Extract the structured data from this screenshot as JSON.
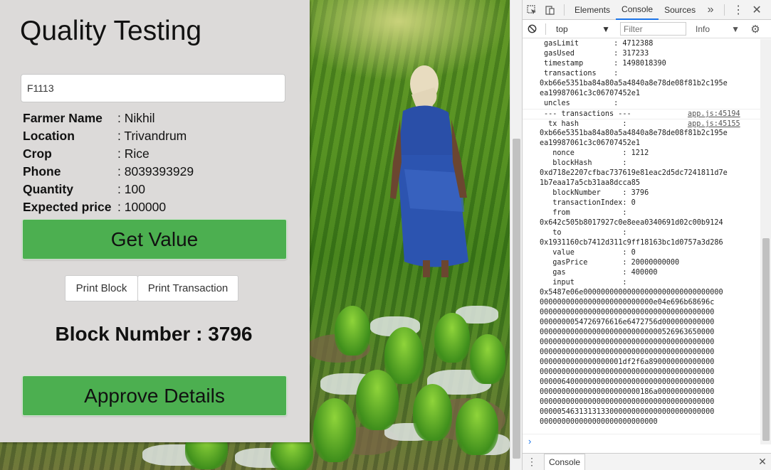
{
  "app": {
    "title": "Quality Testing",
    "farmer_id_value": "F1113",
    "details": [
      {
        "key": "Farmer Name",
        "value": ": Nikhil"
      },
      {
        "key": "Location",
        "value": ": Trivandrum"
      },
      {
        "key": "Crop",
        "value": ": Rice"
      },
      {
        "key": "Phone",
        "value": ": 8039393929"
      },
      {
        "key": "Quantity",
        "value": ": 100"
      },
      {
        "key": "Expected price",
        "value": ": 100000"
      }
    ],
    "get_value_label": "Get Value",
    "print_block_label": "Print Block",
    "print_transaction_label": "Print Transaction",
    "block_number_text": "Block Number : 3796",
    "approve_label": "Approve Details"
  },
  "devtools": {
    "tabs": [
      "Elements",
      "Console",
      "Sources"
    ],
    "active_tab": "Console",
    "more": "»",
    "context": "top",
    "filter_placeholder": "Filter",
    "level": "Info",
    "drawer_tab": "Console",
    "console_lines": [
      {
        "text": "gasLimit        : 4712388",
        "src": ""
      },
      {
        "text": "gasUsed         : 317233",
        "src": ""
      },
      {
        "text": "timestamp       : 1498018390",
        "src": ""
      },
      {
        "text": "transactions    :",
        "src": ""
      },
      {
        "text": "0xb66e5351ba84a80a5a4840a8e78de08f81b2c195e",
        "src": "",
        "flush": true
      },
      {
        "text": "ea19987061c3c06707452e1",
        "src": "",
        "flush": true
      },
      {
        "text": "uncles          :",
        "src": ""
      },
      {
        "text": "--- transactions ---",
        "src": "app.js:45194",
        "sep": true
      },
      {
        "text": " tx hash          :",
        "src": "app.js:45155",
        "sep": true
      },
      {
        "text": "0xb66e5351ba84a80a5a4840a8e78de08f81b2c195e",
        "src": "",
        "flush": true
      },
      {
        "text": "ea19987061c3c06707452e1",
        "src": "",
        "flush": true
      },
      {
        "text": "  nonce           : 1212",
        "src": ""
      },
      {
        "text": "  blockHash       :",
        "src": ""
      },
      {
        "text": "0xd718e2207cfbac737619e81eac2d5dc7241811d7e",
        "src": "",
        "flush": true
      },
      {
        "text": "1b7eaa17a5cb31aa8dcca85",
        "src": "",
        "flush": true
      },
      {
        "text": "  blockNumber     : 3796",
        "src": ""
      },
      {
        "text": "  transactionIndex: 0",
        "src": ""
      },
      {
        "text": "  from            :",
        "src": ""
      },
      {
        "text": "0x642c505b8017927c0e8eea0340691d02c00b9124",
        "src": "",
        "flush": true
      },
      {
        "text": "  to              :",
        "src": ""
      },
      {
        "text": "0x1931160cb7412d311c9ff18163bc1d0757a3d286",
        "src": "",
        "flush": true
      },
      {
        "text": "  value           : 0",
        "src": ""
      },
      {
        "text": "  gasPrice        : 20000000000",
        "src": ""
      },
      {
        "text": "  gas             : 400000",
        "src": ""
      },
      {
        "text": "  input           :",
        "src": ""
      },
      {
        "text": "0x5487e06e00000000000000000000000000000000",
        "src": "",
        "flush": true
      },
      {
        "text": "00000000000000000000000000e04e696b68696c",
        "src": "",
        "flush": true
      },
      {
        "text": "0000000000000000000000000000000000000000",
        "src": "",
        "flush": true
      },
      {
        "text": "0000000054726976616e6472756d000000000000",
        "src": "",
        "flush": true
      },
      {
        "text": "0000000000000000000000000000526963650000",
        "src": "",
        "flush": true
      },
      {
        "text": "0000000000000000000000000000000000000000",
        "src": "",
        "flush": true
      },
      {
        "text": "0000000000000000000000000000000000000000",
        "src": "",
        "flush": true
      },
      {
        "text": "0000000000000000001df2f6a890000000000000",
        "src": "",
        "flush": true
      },
      {
        "text": "0000000000000000000000000000000000000000",
        "src": "",
        "flush": true
      },
      {
        "text": "0000064000000000000000000000000000000000",
        "src": "",
        "flush": true
      },
      {
        "text": "00000000000000000000000186a0000000000000",
        "src": "",
        "flush": true
      },
      {
        "text": "0000000000000000000000000000000000000000",
        "src": "",
        "flush": true
      },
      {
        "text": "0000054631313133000000000000000000000000",
        "src": "",
        "flush": true
      },
      {
        "text": "000000000000000000000000000",
        "src": "",
        "flush": true
      }
    ]
  }
}
